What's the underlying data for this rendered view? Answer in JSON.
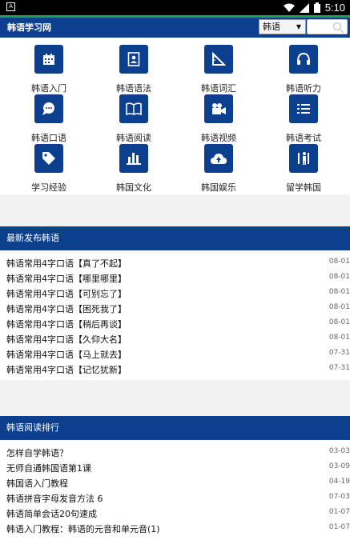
{
  "status_bar": {
    "time": "5:10"
  },
  "header": {
    "title": "韩语学习网",
    "select_value": "韩语",
    "search_placeholder": ""
  },
  "grid": [
    {
      "label": "韩语入门",
      "icon": "calendar-icon"
    },
    {
      "label": "韩语语法",
      "icon": "contact-book-icon"
    },
    {
      "label": "韩语词汇",
      "icon": "ruler-icon"
    },
    {
      "label": "韩语听力",
      "icon": "headphones-icon"
    },
    {
      "label": "韩语口语",
      "icon": "chat-bubble-icon"
    },
    {
      "label": "韩语阅读",
      "icon": "open-book-icon"
    },
    {
      "label": "韩语视频",
      "icon": "video-camera-icon"
    },
    {
      "label": "韩语考试",
      "icon": "list-icon"
    },
    {
      "label": "学习经验",
      "icon": "tag-icon"
    },
    {
      "label": "韩国文化",
      "icon": "bar-chart-icon"
    },
    {
      "label": "韩国娱乐",
      "icon": "cloud-upload-icon"
    },
    {
      "label": "留学韩国",
      "icon": "person-icon"
    }
  ],
  "latest": {
    "heading": "最新发布韩语",
    "items": [
      {
        "title": "韩语常用4字口语【真了不起】",
        "date": "08-01"
      },
      {
        "title": "韩语常用4字口语【哪里哪里】",
        "date": "08-01"
      },
      {
        "title": "韩语常用4字口语【可别忘了】",
        "date": "08-01"
      },
      {
        "title": "韩语常用4字口语【困死我了】",
        "date": "08-01"
      },
      {
        "title": "韩语常用4字口语【稍后再谈】",
        "date": "08-01"
      },
      {
        "title": "韩语常用4字口语【久仰大名】",
        "date": "08-01"
      },
      {
        "title": "韩语常用4字口语【马上就去】",
        "date": "07-31"
      },
      {
        "title": "韩语常用4字口语【记忆犹新】",
        "date": "07-31"
      }
    ]
  },
  "ranking": {
    "heading": "韩语阅读排行",
    "items": [
      {
        "title": "怎样自学韩语？",
        "date": "03-03"
      },
      {
        "title": "无师自通韩国语第1课",
        "date": "03-09"
      },
      {
        "title": "韩国语入门教程",
        "date": "04-19"
      },
      {
        "title": "韩语拼音字母发音方法 6",
        "date": "07-03"
      },
      {
        "title": "韩语简单会话20句速成",
        "date": "01-07"
      },
      {
        "title": "韩语入门教程：韩语的元音和单元音(1)",
        "date": "01-07"
      }
    ]
  }
}
